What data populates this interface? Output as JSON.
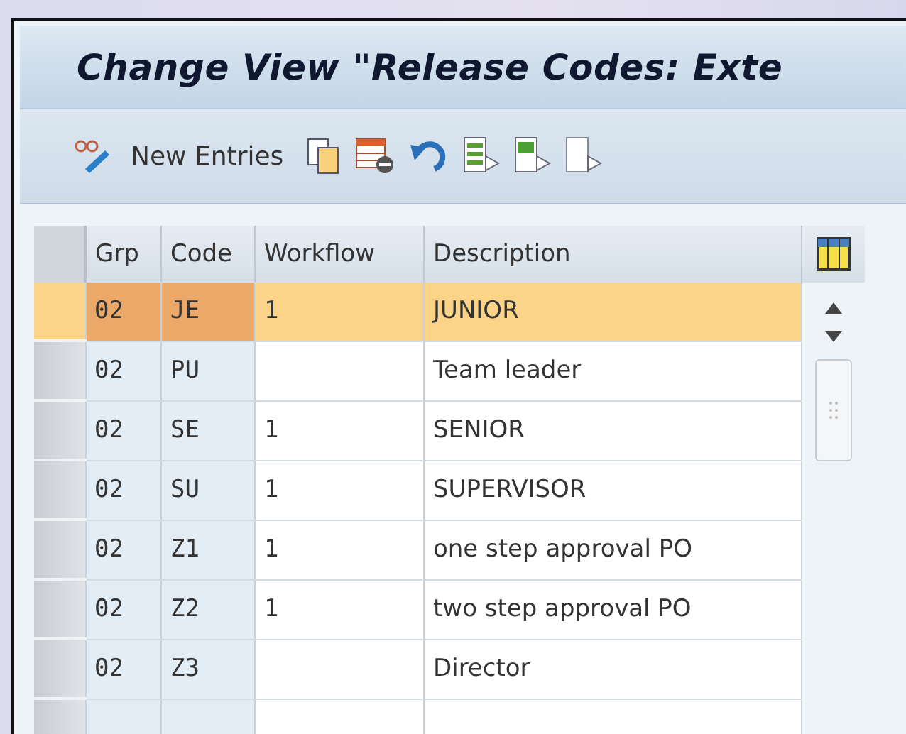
{
  "window": {
    "title": "Change View \"Release Codes: Exte"
  },
  "toolbar": {
    "new_entries": "New Entries"
  },
  "table": {
    "columns": [
      "Grp",
      "Code",
      "Workflow",
      "Description"
    ],
    "rows": [
      {
        "grp": "02",
        "code": "JE",
        "workflow": "1",
        "description": "JUNIOR",
        "selected": true
      },
      {
        "grp": "02",
        "code": "PU",
        "workflow": "",
        "description": "Team leader",
        "selected": false
      },
      {
        "grp": "02",
        "code": "SE",
        "workflow": "1",
        "description": "SENIOR",
        "selected": false
      },
      {
        "grp": "02",
        "code": "SU",
        "workflow": "1",
        "description": "SUPERVISOR",
        "selected": false
      },
      {
        "grp": "02",
        "code": "Z1",
        "workflow": "1",
        "description": "one step approval PO",
        "selected": false
      },
      {
        "grp": "02",
        "code": "Z2",
        "workflow": "1",
        "description": "two step approval PO",
        "selected": false
      },
      {
        "grp": "02",
        "code": "Z3",
        "workflow": "",
        "description": "Director",
        "selected": false
      }
    ]
  }
}
